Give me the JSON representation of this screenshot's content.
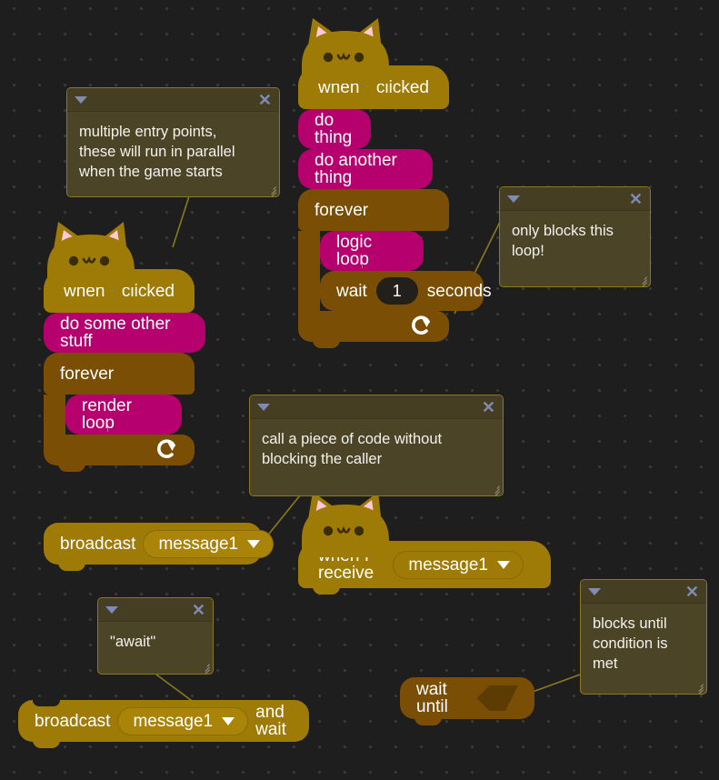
{
  "theme": {
    "canvas_bg": "#1e1e1e",
    "grid_dot": "#3a3a3a",
    "event_block": "#9e7a07",
    "control_block": "#7a4f05",
    "custom_block": "#b5006e",
    "comment_bg": "#4b4426",
    "comment_bar": "#453e22",
    "comment_border": "#8a7a1c",
    "connector_line": "#8a7a1c",
    "flag_green": "#45b84a",
    "cat_ear_pink": "#ffc9dd"
  },
  "scripts": {
    "main": {
      "hat": {
        "when": "when",
        "flag_icon": "green-flag-icon",
        "clicked": "clicked"
      },
      "do_thing": "do thing",
      "do_another_thing": "do another thing",
      "forever": "forever",
      "logic_loop": "logic loop",
      "wait": {
        "prefix": "wait",
        "value": "1",
        "suffix": "seconds"
      },
      "loop_arrow_icon": "loop-arrow-icon"
    },
    "secondary": {
      "hat": {
        "when": "when",
        "flag_icon": "green-flag-icon",
        "clicked": "clicked"
      },
      "do_some_other_stuff": "do some other stuff",
      "forever": "forever",
      "render_loop": "render loop",
      "loop_arrow_icon": "loop-arrow-icon"
    },
    "broadcast": {
      "label": "broadcast",
      "message": "message1",
      "dropdown_icon": "chevron-down-icon"
    },
    "when_i_receive": {
      "label": "when I receive",
      "message": "message1",
      "dropdown_icon": "chevron-down-icon"
    },
    "broadcast_and_wait": {
      "label": "broadcast",
      "message": "message1",
      "suffix": "and wait",
      "dropdown_icon": "chevron-down-icon"
    },
    "wait_until": {
      "label": "wait until",
      "condition": ""
    }
  },
  "comments": [
    {
      "id": "comment-multiple-entry-points",
      "text": "multiple entry points,\nthese will run in parallel\nwhen the game starts",
      "collapse_icon": "chevron-down-icon",
      "close_icon": "close-icon",
      "resize_icon": "resize-grip-icon"
    },
    {
      "id": "comment-only-blocks-this-loop",
      "text": "only blocks this\nloop!",
      "collapse_icon": "chevron-down-icon",
      "close_icon": "close-icon",
      "resize_icon": "resize-grip-icon"
    },
    {
      "id": "comment-call-without-blocking",
      "text": "call a piece of code without\nblocking the caller",
      "collapse_icon": "chevron-down-icon",
      "close_icon": "close-icon",
      "resize_icon": "resize-grip-icon"
    },
    {
      "id": "comment-await",
      "text": "\"await\"",
      "collapse_icon": "chevron-down-icon",
      "close_icon": "close-icon",
      "resize_icon": "resize-grip-icon"
    },
    {
      "id": "comment-blocks-until-condition",
      "text": "blocks until\ncondition is\nmet",
      "collapse_icon": "chevron-down-icon",
      "close_icon": "close-icon",
      "resize_icon": "resize-grip-icon"
    }
  ]
}
